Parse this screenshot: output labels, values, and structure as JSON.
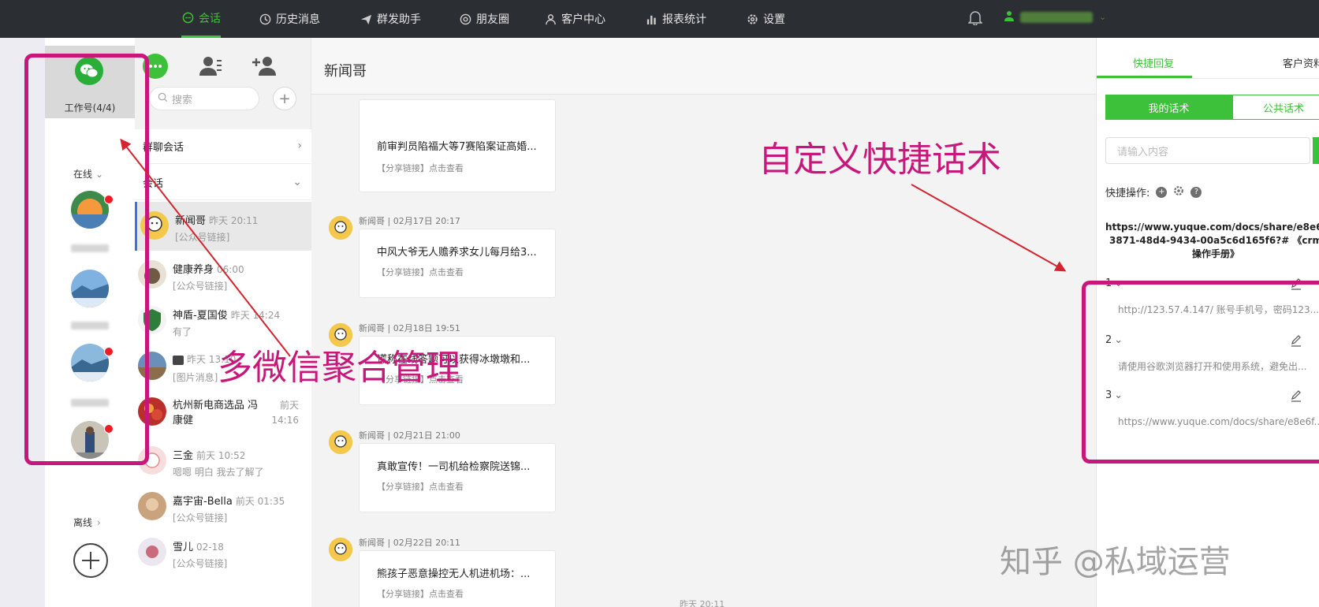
{
  "topbar": {
    "nav": [
      {
        "label": "会话",
        "icon": "chat-bubble-icon",
        "active": true
      },
      {
        "label": "历史消息",
        "icon": "clock-icon"
      },
      {
        "label": "群发助手",
        "icon": "send-icon"
      },
      {
        "label": "朋友圈",
        "icon": "aperture-icon"
      },
      {
        "label": "客户中心",
        "icon": "person-icon"
      },
      {
        "label": "报表统计",
        "icon": "bar-chart-icon"
      },
      {
        "label": "设置",
        "icon": "gear-icon"
      }
    ],
    "accent": "#3ec13a",
    "background": "#2b2e33"
  },
  "accounts": {
    "header_label": "工作号(4/4)",
    "online_label": "在线",
    "offline_label": "离线",
    "items": [
      {
        "unread": true
      },
      {
        "unread": false
      },
      {
        "unread": true
      },
      {
        "unread": true
      }
    ]
  },
  "contacts": {
    "search_placeholder": "搜索",
    "sections": {
      "group_chats": "群聊会话",
      "chats": "会话"
    },
    "items": [
      {
        "name": "新闻哥",
        "time": "昨天 20:11",
        "preview": "[公众号链接]",
        "selected": true
      },
      {
        "name": "健康养身",
        "time": "06:00",
        "preview": "[公众号链接]"
      },
      {
        "name": "神盾-夏国俊",
        "time": "昨天 14:24",
        "preview": "有了"
      },
      {
        "name": "",
        "time": "昨天 13:10",
        "preview": "[图片消息]"
      },
      {
        "name": "杭州新电商选品 冯康健",
        "time": "前天 14:16",
        "preview": ""
      },
      {
        "name": "三金",
        "time": "前天 10:52",
        "preview": "嗯嗯 明白 我去了解了"
      },
      {
        "name": "嘉宇宙-Bella",
        "time": "前天 01:35",
        "preview": "[公众号链接]"
      },
      {
        "name": "雪儿",
        "time": "02-18",
        "preview": "[公众号链接]"
      }
    ]
  },
  "chat": {
    "title": "新闻哥",
    "messages": [
      {
        "meta": "",
        "title": "前审判员陷福大等7赛陷案证高婚...",
        "tag": "【分享链接】点击查看"
      },
      {
        "meta": "新闻哥 | 02月17日 20:17",
        "title": "中风大爷无人赡养求女儿每月给3...",
        "tag": "【分享链接】点击查看"
      },
      {
        "meta": "新闻哥 | 02月18日 19:51",
        "title": "谎称在线答题可以获得冰墩墩和...",
        "tag": "【分享链接】点击查看"
      },
      {
        "meta": "新闻哥 | 02月21日 21:00",
        "title": "真敢宣传！一司机给检察院送锦...",
        "tag": "【分享链接】点击查看"
      },
      {
        "meta": "新闻哥 | 02月22日 20:11",
        "title": "熊孩子恶意操控无人机进机场：...",
        "tag": "【分享链接】点击查看"
      }
    ],
    "footer_time": "昨天 20:11"
  },
  "quick_reply": {
    "tabs": [
      "快捷回复",
      "客户资料"
    ],
    "segments": [
      "我的话术",
      "公共话术"
    ],
    "input_placeholder": "请输入内容",
    "ops_label": "快捷操作:",
    "link_text": "https://www.yuque.com/docs/share/e8e6f15-3871-48d4-9434-00a5c6d165f6?# 《crm操作手册》",
    "items": [
      {
        "num": "1",
        "text": "http://123.57.4.147/ 账号手机号，密码123..."
      },
      {
        "num": "2",
        "text": "请使用谷歌浏览器打开和使用系统，避免出..."
      },
      {
        "num": "3",
        "text": "https://www.yuque.com/docs/share/e8e6f..."
      }
    ]
  },
  "annotations": {
    "left_label": "多微信聚合管理",
    "right_label": "自定义快捷话术",
    "color": "#c8177a"
  },
  "watermark": "知乎 @私域运营"
}
